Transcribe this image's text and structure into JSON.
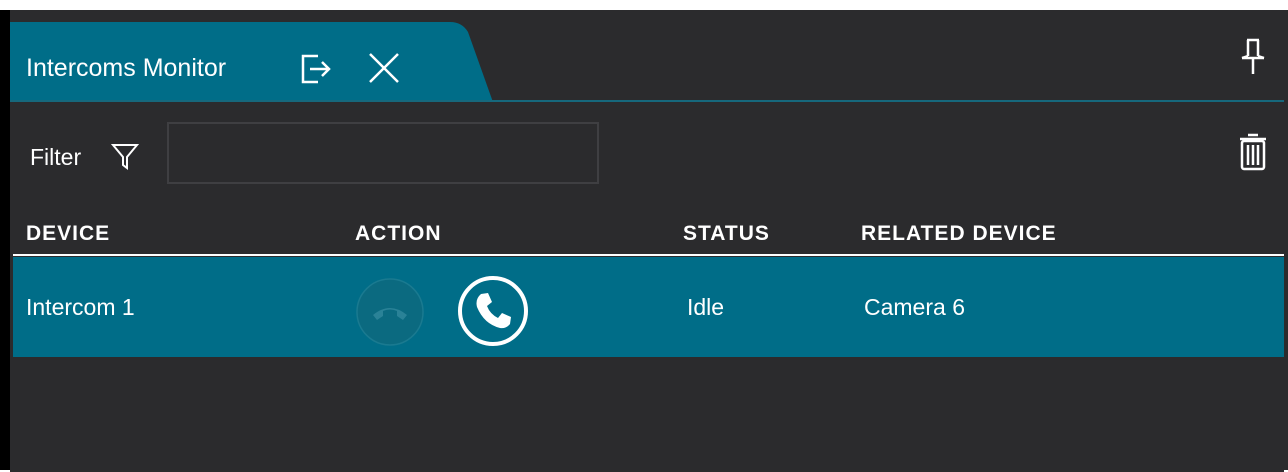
{
  "tab": {
    "title": "Intercoms Monitor",
    "detach_icon": "detach-icon",
    "close_icon": "close-icon",
    "pin_icon": "pin-icon"
  },
  "filter": {
    "label": "Filter",
    "icon": "filter-icon",
    "value": "",
    "clear_icon": "trash-icon"
  },
  "table": {
    "columns": [
      "DEVICE",
      "ACTION",
      "STATUS",
      "RELATED DEVICE"
    ],
    "rows": [
      {
        "device": "Intercom 1",
        "actions": [
          "hang-up-icon",
          "call-icon"
        ],
        "status": "Idle",
        "related_device": "Camera 6"
      }
    ]
  },
  "colors": {
    "accent": "#006d88",
    "background": "#2b2b2d",
    "text": "#ffffff"
  }
}
